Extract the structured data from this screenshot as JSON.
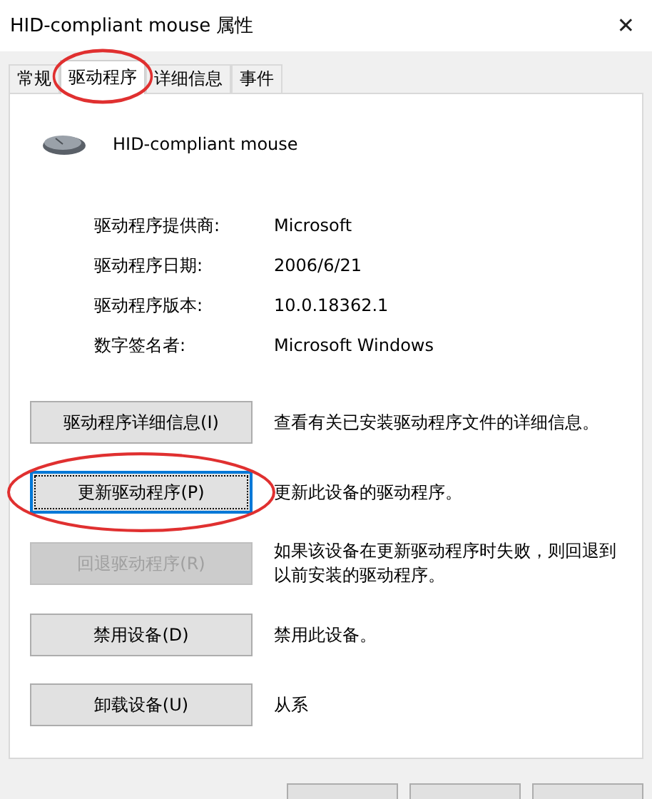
{
  "window": {
    "title": "HID-compliant mouse 属性",
    "close": "✕"
  },
  "tabs": [
    {
      "label": "常规",
      "selected": false,
      "circled": false
    },
    {
      "label": "驱动程序",
      "selected": true,
      "circled": true
    },
    {
      "label": "详细信息",
      "selected": false,
      "circled": false
    },
    {
      "label": "事件",
      "selected": false,
      "circled": false
    }
  ],
  "device": {
    "name": "HID-compliant mouse"
  },
  "properties": [
    {
      "label": "驱动程序提供商:",
      "value": "Microsoft"
    },
    {
      "label": "驱动程序日期:",
      "value": "2006/6/21"
    },
    {
      "label": "驱动程序版本:",
      "value": "10.0.18362.1"
    },
    {
      "label": "数字签名者:",
      "value": "Microsoft Windows"
    }
  ],
  "actions": [
    {
      "button": "驱动程序详细信息(I)",
      "description": "查看有关已安装驱动程序文件的详细信息。",
      "disabled": false,
      "focused": false,
      "circled": false
    },
    {
      "button": "更新驱动程序(P)",
      "description": "更新此设备的驱动程序。",
      "disabled": false,
      "focused": true,
      "circled": true
    },
    {
      "button": "回退驱动程序(R)",
      "description": "如果该设备在更新驱动程序时失败，则回退到以前安装的驱动程序。",
      "disabled": true,
      "focused": false,
      "circled": false
    },
    {
      "button": "禁用设备(D)",
      "description": "禁用此设备。",
      "disabled": false,
      "focused": false,
      "circled": false
    },
    {
      "button": "卸载设备(U)",
      "description": "从系",
      "disabled": false,
      "focused": false,
      "circled": false
    }
  ]
}
